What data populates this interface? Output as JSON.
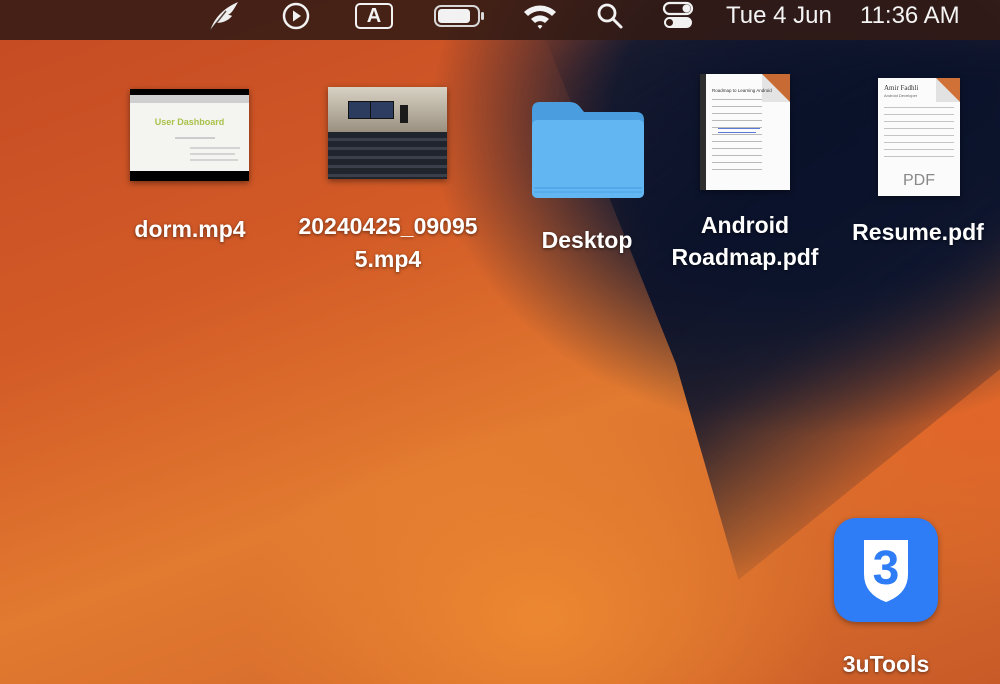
{
  "menubar": {
    "status_icons": [
      "quill-icon",
      "play-circle-icon",
      "input-source-icon",
      "battery-icon",
      "wifi-icon",
      "spotlight-search-icon",
      "control-center-icon"
    ],
    "input_source_letter": "A",
    "date": "Tue 4 Jun",
    "time": "11:36 AM"
  },
  "desktop": {
    "items": [
      {
        "label": "dorm.mp4",
        "kind": "video",
        "thumbnail_text": "User Dashboard"
      },
      {
        "label_line1": "20240425_09095",
        "label_line2": "5.mp4",
        "kind": "video"
      },
      {
        "label": "Desktop",
        "kind": "folder"
      },
      {
        "label_line1": "Android",
        "label_line2": "Roadmap.pdf",
        "kind": "pdf",
        "doc_title": "Roadmap to Learning Android"
      },
      {
        "label": "Resume.pdf",
        "kind": "pdf",
        "doc_name": "Amir Fadhli",
        "doc_subtitle": "Android Developer",
        "badge": "PDF"
      },
      {
        "label": "3uTools",
        "kind": "app",
        "glyph": "3"
      }
    ]
  },
  "colors": {
    "folder_blue": "#5db3f0",
    "app_blue": "#2e7cf6",
    "menubar_bg": "#321a14"
  }
}
